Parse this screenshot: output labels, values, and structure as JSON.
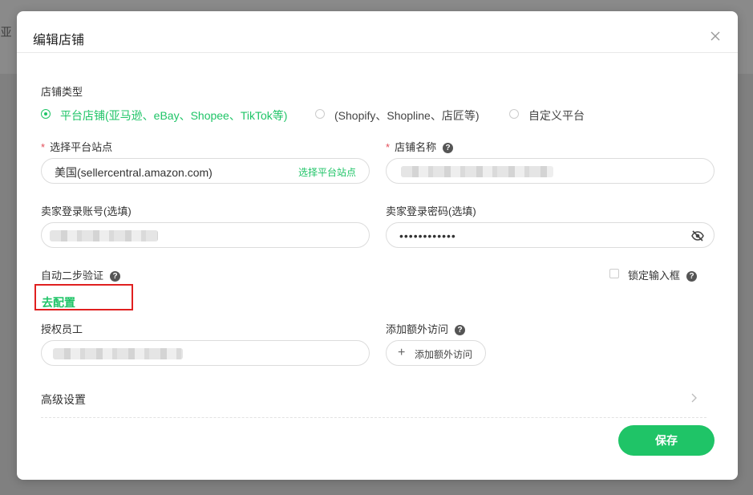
{
  "background": {
    "partial_text": "-亚"
  },
  "dialog": {
    "title": "编辑店铺",
    "store_type": {
      "label": "店铺类型",
      "options": [
        {
          "label": "平台店铺(亚马逊、eBay、Shopee、TikTok等)",
          "selected": true
        },
        {
          "label": "(Shopify、Shopline、店匠等)",
          "selected": false
        },
        {
          "label": "自定义平台",
          "selected": false
        }
      ]
    },
    "platform_site": {
      "label": "选择平台站点",
      "value": "美国(sellercentral.amazon.com)",
      "action": "选择平台站点"
    },
    "store_name": {
      "label": "店铺名称"
    },
    "seller_account": {
      "label": "卖家登录账号(选填)"
    },
    "seller_password": {
      "label": "卖家登录密码(选填)",
      "masked_value": "••••••••••••"
    },
    "two_step": {
      "label": "自动二步验证",
      "config_link": "去配置"
    },
    "lock_input": {
      "label": "锁定输入框",
      "checked": false
    },
    "authorized_staff": {
      "label": "授权员工"
    },
    "extra_access": {
      "label": "添加额外访问",
      "button": "添加额外访问"
    },
    "advanced": {
      "label": "高级设置"
    },
    "save_button": "保存"
  },
  "colors": {
    "accent": "#1fc467",
    "required": "#e34d59",
    "highlight": "#e02020"
  },
  "icons": [
    "close-icon",
    "help-icon",
    "eye-off-icon",
    "plus-icon",
    "chevron-right-icon"
  ]
}
